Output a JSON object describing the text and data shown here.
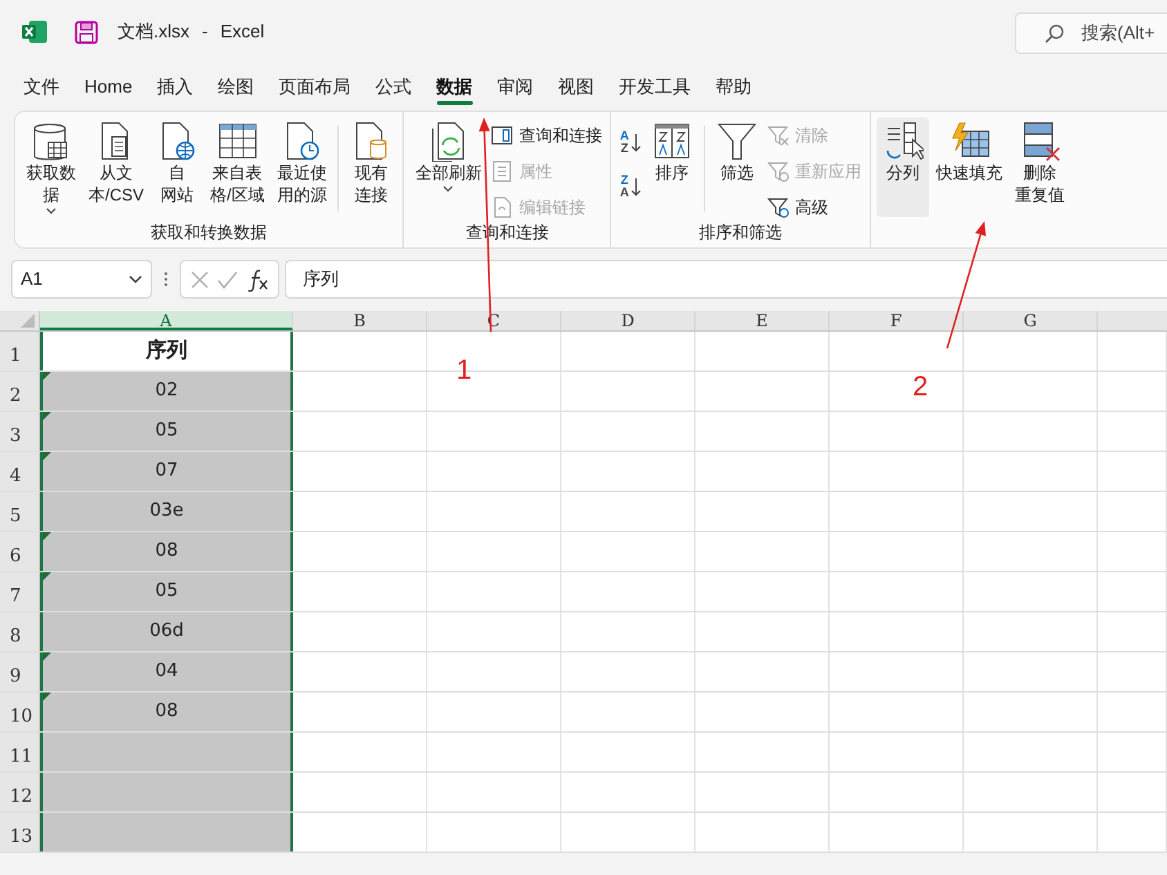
{
  "title_bar": {
    "file_name": "文档.xlsx",
    "separator": "-",
    "app_name": "Excel",
    "search_placeholder": "搜索(Alt+"
  },
  "menu_tabs": [
    {
      "label": "文件",
      "selected": false
    },
    {
      "label": "Home",
      "selected": false
    },
    {
      "label": "插入",
      "selected": false
    },
    {
      "label": "绘图",
      "selected": false
    },
    {
      "label": "页面布局",
      "selected": false
    },
    {
      "label": "公式",
      "selected": false
    },
    {
      "label": "数据",
      "selected": true
    },
    {
      "label": "审阅",
      "selected": false
    },
    {
      "label": "视图",
      "selected": false
    },
    {
      "label": "开发工具",
      "selected": false
    },
    {
      "label": "帮助",
      "selected": false
    }
  ],
  "ribbon": {
    "groups": [
      {
        "label": "获取和转换数据",
        "buttons": [
          {
            "kind": "large",
            "lines": [
              "获取数",
              "据"
            ],
            "dropdown": true,
            "highlighted": false
          },
          {
            "kind": "large",
            "lines": [
              "从文",
              "本/CSV"
            ],
            "dropdown": false,
            "highlighted": false
          },
          {
            "kind": "large",
            "lines": [
              "自",
              "网站"
            ],
            "dropdown": false,
            "highlighted": false
          },
          {
            "kind": "large",
            "lines": [
              "来自表",
              "格/区域"
            ],
            "dropdown": false,
            "highlighted": false
          },
          {
            "kind": "large",
            "lines": [
              "最近使",
              "用的源"
            ],
            "dropdown": false,
            "highlighted": false
          },
          {
            "kind": "separator"
          },
          {
            "kind": "large",
            "lines": [
              "现有",
              "连接"
            ],
            "dropdown": false,
            "highlighted": false
          }
        ]
      },
      {
        "label": "查询和连接",
        "buttons": [
          {
            "kind": "large",
            "lines": [
              "全部刷新"
            ],
            "dropdown": true,
            "highlighted": false
          },
          {
            "kind": "small_stack",
            "items": [
              {
                "label": "查询和连接",
                "disabled": false
              },
              {
                "label": "属性",
                "disabled": true
              },
              {
                "label": "编辑链接",
                "disabled": true
              }
            ]
          }
        ]
      },
      {
        "label": "排序和筛选",
        "buttons": [
          {
            "kind": "sort_stack",
            "items": [
              {
                "top": "A",
                "bottom": "Z"
              },
              {
                "top": "Z",
                "bottom": "A"
              }
            ]
          },
          {
            "kind": "large",
            "lines": [
              "排序"
            ],
            "dropdown": false,
            "highlighted": false
          },
          {
            "kind": "separator"
          },
          {
            "kind": "large",
            "lines": [
              "筛选"
            ],
            "dropdown": false,
            "highlighted": false
          },
          {
            "kind": "small_stack",
            "items": [
              {
                "label": "清除",
                "disabled": true
              },
              {
                "label": "重新应用",
                "disabled": true
              },
              {
                "label": "高级",
                "disabled": false
              }
            ]
          }
        ]
      },
      {
        "buttons": [
          {
            "kind": "large",
            "lines": [
              "分列"
            ],
            "dropdown": false,
            "highlighted": true
          },
          {
            "kind": "large",
            "lines": [
              "快速填充"
            ],
            "dropdown": false,
            "highlighted": false
          },
          {
            "kind": "large",
            "lines": [
              "删除",
              "重复值"
            ],
            "dropdown": false,
            "highlighted": false
          }
        ]
      }
    ]
  },
  "formula_bar": {
    "name_box": "A1",
    "formula": "序列"
  },
  "sheet": {
    "columns": [
      {
        "label": "A",
        "selected": true
      },
      {
        "label": "B",
        "selected": false
      },
      {
        "label": "C",
        "selected": false
      },
      {
        "label": "D",
        "selected": false
      },
      {
        "label": "E",
        "selected": false
      },
      {
        "label": "F",
        "selected": false
      },
      {
        "label": "G",
        "selected": false
      }
    ],
    "rows": [
      {
        "label": "1",
        "value": "序列",
        "header": true,
        "text_number_marker": false,
        "selected": false
      },
      {
        "label": "2",
        "value": "02",
        "header": false,
        "text_number_marker": true,
        "selected": true
      },
      {
        "label": "3",
        "value": "05",
        "header": false,
        "text_number_marker": true,
        "selected": true
      },
      {
        "label": "4",
        "value": "07",
        "header": false,
        "text_number_marker": true,
        "selected": true
      },
      {
        "label": "5",
        "value": "03e",
        "header": false,
        "text_number_marker": false,
        "selected": true
      },
      {
        "label": "6",
        "value": "08",
        "header": false,
        "text_number_marker": true,
        "selected": true
      },
      {
        "label": "7",
        "value": "05",
        "header": false,
        "text_number_marker": true,
        "selected": true
      },
      {
        "label": "8",
        "value": "06d",
        "header": false,
        "text_number_marker": false,
        "selected": true
      },
      {
        "label": "9",
        "value": "04",
        "header": false,
        "text_number_marker": true,
        "selected": true
      },
      {
        "label": "10",
        "value": "08",
        "header": false,
        "text_number_marker": true,
        "selected": true
      },
      {
        "label": "11",
        "header": false,
        "text_number_marker": false,
        "selected": true
      },
      {
        "label": "12",
        "header": false,
        "text_number_marker": false,
        "selected": true
      },
      {
        "label": "13",
        "header": false,
        "text_number_marker": false,
        "selected": true
      }
    ]
  },
  "annotations": [
    {
      "label": "1"
    },
    {
      "label": "2"
    }
  ]
}
